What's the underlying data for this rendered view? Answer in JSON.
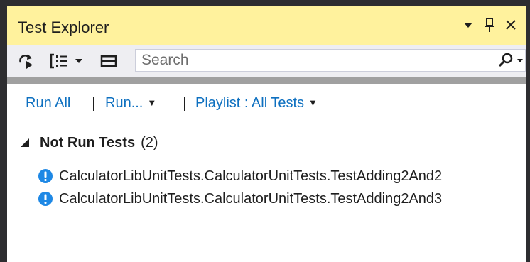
{
  "window": {
    "title": "Test Explorer",
    "title_buttons": {
      "menu_icon": "chevron-down-icon",
      "pin_icon": "pin-icon",
      "close_icon": "close-icon"
    }
  },
  "toolbar": {
    "tools": [
      {
        "icon": "run-tests-after-build-icon"
      },
      {
        "icon": "group-by-icon",
        "has_dropdown": true
      },
      {
        "icon": "list-view-icon"
      }
    ],
    "search": {
      "placeholder": "Search",
      "icon": "search-icon"
    }
  },
  "actions": {
    "run_all": "Run All",
    "run": "Run...",
    "playlist": "Playlist : All Tests"
  },
  "tests": {
    "group": {
      "label": "Not Run Tests",
      "count": "(2)",
      "expanded": true
    },
    "items": [
      {
        "name": "CalculatorLibUnitTests.CalculatorUnitTests.TestAdding2And2",
        "status": "not-run",
        "icon": "not-run-icon"
      },
      {
        "name": "CalculatorLibUnitTests.CalculatorUnitTests.TestAdding2And3",
        "status": "not-run",
        "icon": "not-run-icon"
      }
    ]
  },
  "colors": {
    "title_bar": "#fff29d",
    "toolbar": "#eeeef2",
    "link": "#0e70c0",
    "not_run_icon": "#1e88e5",
    "frame": "#2d2d30"
  }
}
